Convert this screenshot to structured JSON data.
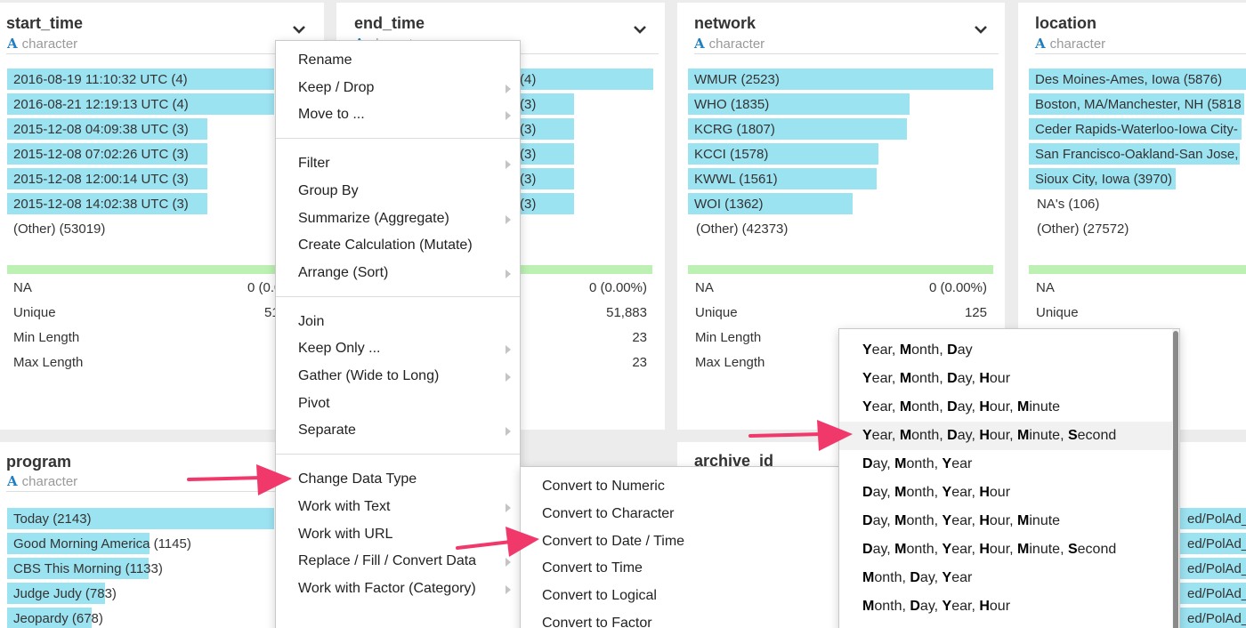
{
  "colors": {
    "bar": "#9ce3f2",
    "na_bar": "#bdf0b3",
    "arrow": "#f0386b",
    "type_icon": "#1e7fc4"
  },
  "cards": {
    "start_time": {
      "title": "start_time",
      "type_icon": "A",
      "type": "character",
      "bars": [
        {
          "label": "2016-08-19 11:10:32 UTC (4)",
          "fraction": 1.0
        },
        {
          "label": "2016-08-21 12:19:13 UTC (4)",
          "fraction": 1.0
        },
        {
          "label": "2015-12-08 04:09:38 UTC (3)",
          "fraction": 0.75
        },
        {
          "label": "2015-12-08 07:02:26 UTC (3)",
          "fraction": 0.75
        },
        {
          "label": "2015-12-08 12:00:14 UTC (3)",
          "fraction": 0.75
        },
        {
          "label": "2015-12-08 14:02:38 UTC (3)",
          "fraction": 0.75
        }
      ],
      "other": "(Other) (53019)",
      "stats": [
        {
          "label": "NA",
          "value": "0 (0.0"
        },
        {
          "label": "Unique",
          "value": "51"
        },
        {
          "label": "Min Length",
          "value": ""
        },
        {
          "label": "Max Length",
          "value": ""
        }
      ]
    },
    "end_time": {
      "title": "end_time",
      "type_icon": "A",
      "type": "character",
      "bars": [
        {
          "label": "(4)",
          "fraction": 1.0
        },
        {
          "label": "(3)",
          "fraction": 0.75
        },
        {
          "label": "(3)",
          "fraction": 0.75
        },
        {
          "label": "(3)",
          "fraction": 0.75
        },
        {
          "label": "(3)",
          "fraction": 0.75
        },
        {
          "label": "(3)",
          "fraction": 0.75
        }
      ],
      "stats": [
        {
          "label": "",
          "value": "0 (0.00%)"
        },
        {
          "label": "",
          "value": "51,883"
        },
        {
          "label": "",
          "value": "23"
        },
        {
          "label": "",
          "value": "23"
        }
      ]
    },
    "network": {
      "title": "network",
      "type_icon": "A",
      "type": "character",
      "bars": [
        {
          "label": "WMUR (2523)",
          "fraction": 1.0
        },
        {
          "label": "WHO (1835)",
          "fraction": 0.727
        },
        {
          "label": "KCRG (1807)",
          "fraction": 0.716
        },
        {
          "label": "KCCI (1578)",
          "fraction": 0.625
        },
        {
          "label": "KWWL (1561)",
          "fraction": 0.619
        },
        {
          "label": "WOI (1362)",
          "fraction": 0.54
        }
      ],
      "other": "(Other) (42373)",
      "stats": [
        {
          "label": "NA",
          "value": "0 (0.00%)"
        },
        {
          "label": "Unique",
          "value": "125"
        },
        {
          "label": "Min Length",
          "value": ""
        },
        {
          "label": "Max Length",
          "value": ""
        }
      ]
    },
    "location": {
      "title": "location",
      "type_icon": "A",
      "type": "character",
      "bars": [
        {
          "label": "Des Moines-Ames, Iowa (5876)",
          "fraction": 1.0
        },
        {
          "label": "Boston, MA/Manchester, NH (5818",
          "fraction": 0.99
        },
        {
          "label": "Ceder Rapids-Waterloo-Iowa City-",
          "fraction": 0.98
        },
        {
          "label": "San Francisco-Oakland-San Jose,",
          "fraction": 0.97
        },
        {
          "label": "Sioux City, Iowa (3970)",
          "fraction": 0.676
        }
      ],
      "na_row": "NA's (106)",
      "other": "(Other) (27572)",
      "stats": [
        {
          "label": "NA",
          "value": ""
        },
        {
          "label": "Unique",
          "value": ""
        }
      ]
    },
    "program": {
      "title": "program",
      "type_icon": "A",
      "type": "character",
      "bars": [
        {
          "label": "Today (2143)",
          "fraction": 1.0
        },
        {
          "label": "Good Morning America (1145)",
          "fraction": 0.534
        },
        {
          "label": "CBS This Morning (1133)",
          "fraction": 0.529
        },
        {
          "label": "Judge Judy (783)",
          "fraction": 0.365
        },
        {
          "label": "Jeopardy (678)",
          "fraction": 0.316
        }
      ]
    },
    "archive_id": {
      "title": "archive_id"
    },
    "right_bottom": {
      "bars": [
        {
          "label": "ed/PolAd_"
        },
        {
          "label": "ed/PolAd_"
        },
        {
          "label": "ed/PolAd_"
        },
        {
          "label": "ed/PolAd_"
        },
        {
          "label": "ed/PolAd_"
        }
      ]
    }
  },
  "context_menu": {
    "groups": [
      [
        {
          "label": "Rename",
          "submenu": false
        },
        {
          "label": "Keep / Drop",
          "submenu": true
        },
        {
          "label": "Move to ...",
          "submenu": true
        }
      ],
      [
        {
          "label": "Filter",
          "submenu": true
        },
        {
          "label": "Group By",
          "submenu": false
        },
        {
          "label": "Summarize (Aggregate)",
          "submenu": true
        },
        {
          "label": "Create Calculation (Mutate)",
          "submenu": false
        },
        {
          "label": "Arrange (Sort)",
          "submenu": true
        }
      ],
      [
        {
          "label": "Join",
          "submenu": false
        },
        {
          "label": "Keep Only ...",
          "submenu": true
        },
        {
          "label": "Gather (Wide to Long)",
          "submenu": true
        },
        {
          "label": "Pivot",
          "submenu": false
        },
        {
          "label": "Separate",
          "submenu": true
        }
      ],
      [
        {
          "label": "Change Data Type",
          "submenu": false
        },
        {
          "label": "Work with Text",
          "submenu": true
        },
        {
          "label": "Work with URL",
          "submenu": false
        },
        {
          "label": "Replace / Fill / Convert Data",
          "submenu": true
        },
        {
          "label": "Work with Factor (Category)",
          "submenu": true
        }
      ]
    ]
  },
  "convert_menu": {
    "items": [
      "Convert to Numeric",
      "Convert to Character",
      "Convert to Date / Time",
      "Convert to Time",
      "Convert to Logical",
      "Convert to Factor"
    ]
  },
  "date_format_menu": {
    "highlighted_index": 3,
    "items": [
      [
        [
          "Y",
          "ear, "
        ],
        [
          "M",
          "onth, "
        ],
        [
          "D",
          "ay"
        ]
      ],
      [
        [
          "Y",
          "ear, "
        ],
        [
          "M",
          "onth, "
        ],
        [
          "D",
          "ay, "
        ],
        [
          "H",
          "our"
        ]
      ],
      [
        [
          "Y",
          "ear, "
        ],
        [
          "M",
          "onth, "
        ],
        [
          "D",
          "ay, "
        ],
        [
          "H",
          "our, "
        ],
        [
          "M",
          "inute"
        ]
      ],
      [
        [
          "Y",
          "ear, "
        ],
        [
          "M",
          "onth, "
        ],
        [
          "D",
          "ay, "
        ],
        [
          "H",
          "our, "
        ],
        [
          "M",
          "inute, "
        ],
        [
          "S",
          "econd"
        ]
      ],
      [
        [
          "D",
          "ay, "
        ],
        [
          "M",
          "onth, "
        ],
        [
          "Y",
          "ear"
        ]
      ],
      [
        [
          "D",
          "ay, "
        ],
        [
          "M",
          "onth, "
        ],
        [
          "Y",
          "ear, "
        ],
        [
          "H",
          "our"
        ]
      ],
      [
        [
          "D",
          "ay, "
        ],
        [
          "M",
          "onth, "
        ],
        [
          "Y",
          "ear, "
        ],
        [
          "H",
          "our, "
        ],
        [
          "M",
          "inute"
        ]
      ],
      [
        [
          "D",
          "ay, "
        ],
        [
          "M",
          "onth, "
        ],
        [
          "Y",
          "ear, "
        ],
        [
          "H",
          "our, "
        ],
        [
          "M",
          "inute, "
        ],
        [
          "S",
          "econd"
        ]
      ],
      [
        [
          "M",
          "onth, "
        ],
        [
          "D",
          "ay, "
        ],
        [
          "Y",
          "ear"
        ]
      ],
      [
        [
          "M",
          "onth, "
        ],
        [
          "D",
          "ay, "
        ],
        [
          "Y",
          "ear, "
        ],
        [
          "H",
          "our"
        ]
      ]
    ]
  }
}
